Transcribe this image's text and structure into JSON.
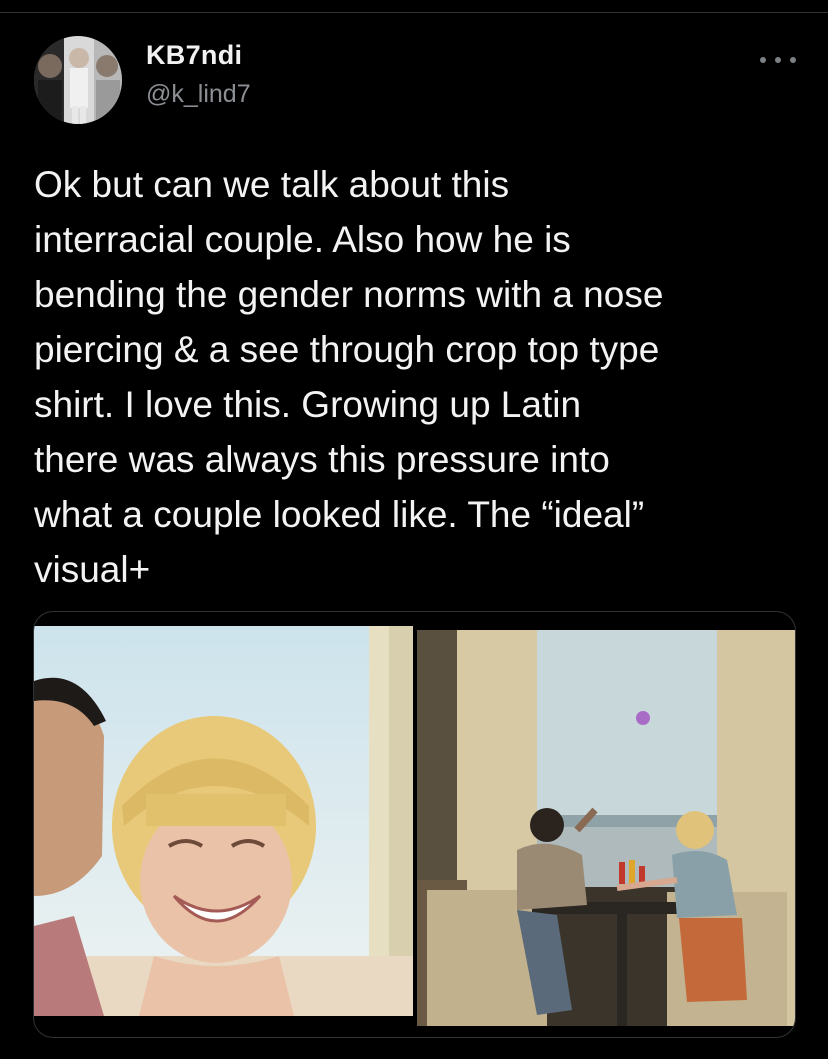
{
  "tweet": {
    "author": {
      "display_name": "KB7ndi",
      "handle": "@k_lind7"
    },
    "text": "Ok but can we talk about this\ninterracial couple. Also how he is\nbending the gender norms with a nose\npiercing & a see through crop top type\nshirt. I love this. Growing up Latin\nthere was always this pressure into\nwhat a couple looked like. The “ideal”\nvisual+",
    "more_icon": "more-horizontal-icon",
    "media": [
      {
        "kind": "photo"
      },
      {
        "kind": "photo"
      }
    ]
  },
  "theme": {
    "background": "#000000",
    "text": "#f3f3f3",
    "muted": "#8b8f94",
    "border": "#2f3336"
  }
}
